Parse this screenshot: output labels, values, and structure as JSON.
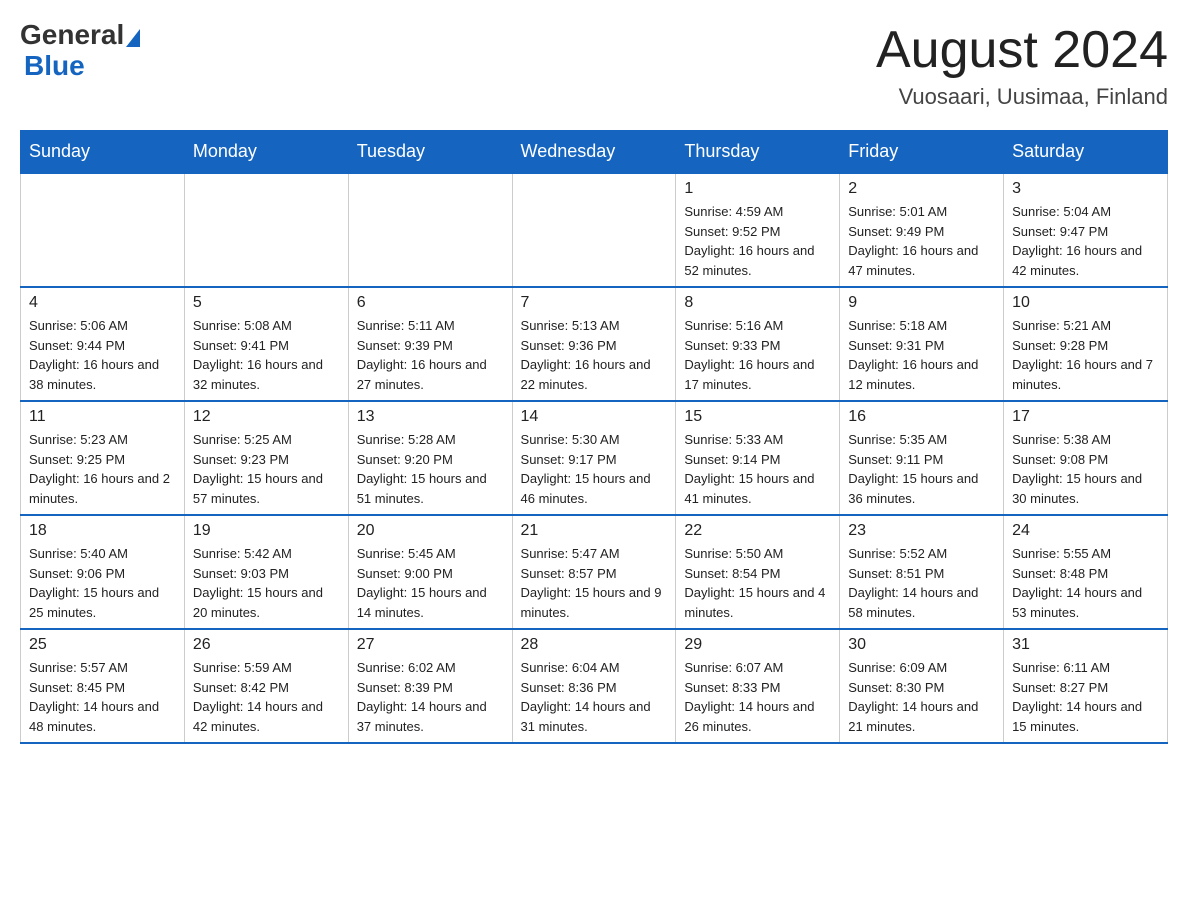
{
  "header": {
    "logo_general": "General",
    "logo_blue": "Blue",
    "month_title": "August 2024",
    "location": "Vuosaari, Uusimaa, Finland"
  },
  "days_of_week": [
    "Sunday",
    "Monday",
    "Tuesday",
    "Wednesday",
    "Thursday",
    "Friday",
    "Saturday"
  ],
  "weeks": [
    [
      {
        "day": "",
        "info": ""
      },
      {
        "day": "",
        "info": ""
      },
      {
        "day": "",
        "info": ""
      },
      {
        "day": "",
        "info": ""
      },
      {
        "day": "1",
        "info": "Sunrise: 4:59 AM\nSunset: 9:52 PM\nDaylight: 16 hours and 52 minutes."
      },
      {
        "day": "2",
        "info": "Sunrise: 5:01 AM\nSunset: 9:49 PM\nDaylight: 16 hours and 47 minutes."
      },
      {
        "day": "3",
        "info": "Sunrise: 5:04 AM\nSunset: 9:47 PM\nDaylight: 16 hours and 42 minutes."
      }
    ],
    [
      {
        "day": "4",
        "info": "Sunrise: 5:06 AM\nSunset: 9:44 PM\nDaylight: 16 hours and 38 minutes."
      },
      {
        "day": "5",
        "info": "Sunrise: 5:08 AM\nSunset: 9:41 PM\nDaylight: 16 hours and 32 minutes."
      },
      {
        "day": "6",
        "info": "Sunrise: 5:11 AM\nSunset: 9:39 PM\nDaylight: 16 hours and 27 minutes."
      },
      {
        "day": "7",
        "info": "Sunrise: 5:13 AM\nSunset: 9:36 PM\nDaylight: 16 hours and 22 minutes."
      },
      {
        "day": "8",
        "info": "Sunrise: 5:16 AM\nSunset: 9:33 PM\nDaylight: 16 hours and 17 minutes."
      },
      {
        "day": "9",
        "info": "Sunrise: 5:18 AM\nSunset: 9:31 PM\nDaylight: 16 hours and 12 minutes."
      },
      {
        "day": "10",
        "info": "Sunrise: 5:21 AM\nSunset: 9:28 PM\nDaylight: 16 hours and 7 minutes."
      }
    ],
    [
      {
        "day": "11",
        "info": "Sunrise: 5:23 AM\nSunset: 9:25 PM\nDaylight: 16 hours and 2 minutes."
      },
      {
        "day": "12",
        "info": "Sunrise: 5:25 AM\nSunset: 9:23 PM\nDaylight: 15 hours and 57 minutes."
      },
      {
        "day": "13",
        "info": "Sunrise: 5:28 AM\nSunset: 9:20 PM\nDaylight: 15 hours and 51 minutes."
      },
      {
        "day": "14",
        "info": "Sunrise: 5:30 AM\nSunset: 9:17 PM\nDaylight: 15 hours and 46 minutes."
      },
      {
        "day": "15",
        "info": "Sunrise: 5:33 AM\nSunset: 9:14 PM\nDaylight: 15 hours and 41 minutes."
      },
      {
        "day": "16",
        "info": "Sunrise: 5:35 AM\nSunset: 9:11 PM\nDaylight: 15 hours and 36 minutes."
      },
      {
        "day": "17",
        "info": "Sunrise: 5:38 AM\nSunset: 9:08 PM\nDaylight: 15 hours and 30 minutes."
      }
    ],
    [
      {
        "day": "18",
        "info": "Sunrise: 5:40 AM\nSunset: 9:06 PM\nDaylight: 15 hours and 25 minutes."
      },
      {
        "day": "19",
        "info": "Sunrise: 5:42 AM\nSunset: 9:03 PM\nDaylight: 15 hours and 20 minutes."
      },
      {
        "day": "20",
        "info": "Sunrise: 5:45 AM\nSunset: 9:00 PM\nDaylight: 15 hours and 14 minutes."
      },
      {
        "day": "21",
        "info": "Sunrise: 5:47 AM\nSunset: 8:57 PM\nDaylight: 15 hours and 9 minutes."
      },
      {
        "day": "22",
        "info": "Sunrise: 5:50 AM\nSunset: 8:54 PM\nDaylight: 15 hours and 4 minutes."
      },
      {
        "day": "23",
        "info": "Sunrise: 5:52 AM\nSunset: 8:51 PM\nDaylight: 14 hours and 58 minutes."
      },
      {
        "day": "24",
        "info": "Sunrise: 5:55 AM\nSunset: 8:48 PM\nDaylight: 14 hours and 53 minutes."
      }
    ],
    [
      {
        "day": "25",
        "info": "Sunrise: 5:57 AM\nSunset: 8:45 PM\nDaylight: 14 hours and 48 minutes."
      },
      {
        "day": "26",
        "info": "Sunrise: 5:59 AM\nSunset: 8:42 PM\nDaylight: 14 hours and 42 minutes."
      },
      {
        "day": "27",
        "info": "Sunrise: 6:02 AM\nSunset: 8:39 PM\nDaylight: 14 hours and 37 minutes."
      },
      {
        "day": "28",
        "info": "Sunrise: 6:04 AM\nSunset: 8:36 PM\nDaylight: 14 hours and 31 minutes."
      },
      {
        "day": "29",
        "info": "Sunrise: 6:07 AM\nSunset: 8:33 PM\nDaylight: 14 hours and 26 minutes."
      },
      {
        "day": "30",
        "info": "Sunrise: 6:09 AM\nSunset: 8:30 PM\nDaylight: 14 hours and 21 minutes."
      },
      {
        "day": "31",
        "info": "Sunrise: 6:11 AM\nSunset: 8:27 PM\nDaylight: 14 hours and 15 minutes."
      }
    ]
  ]
}
